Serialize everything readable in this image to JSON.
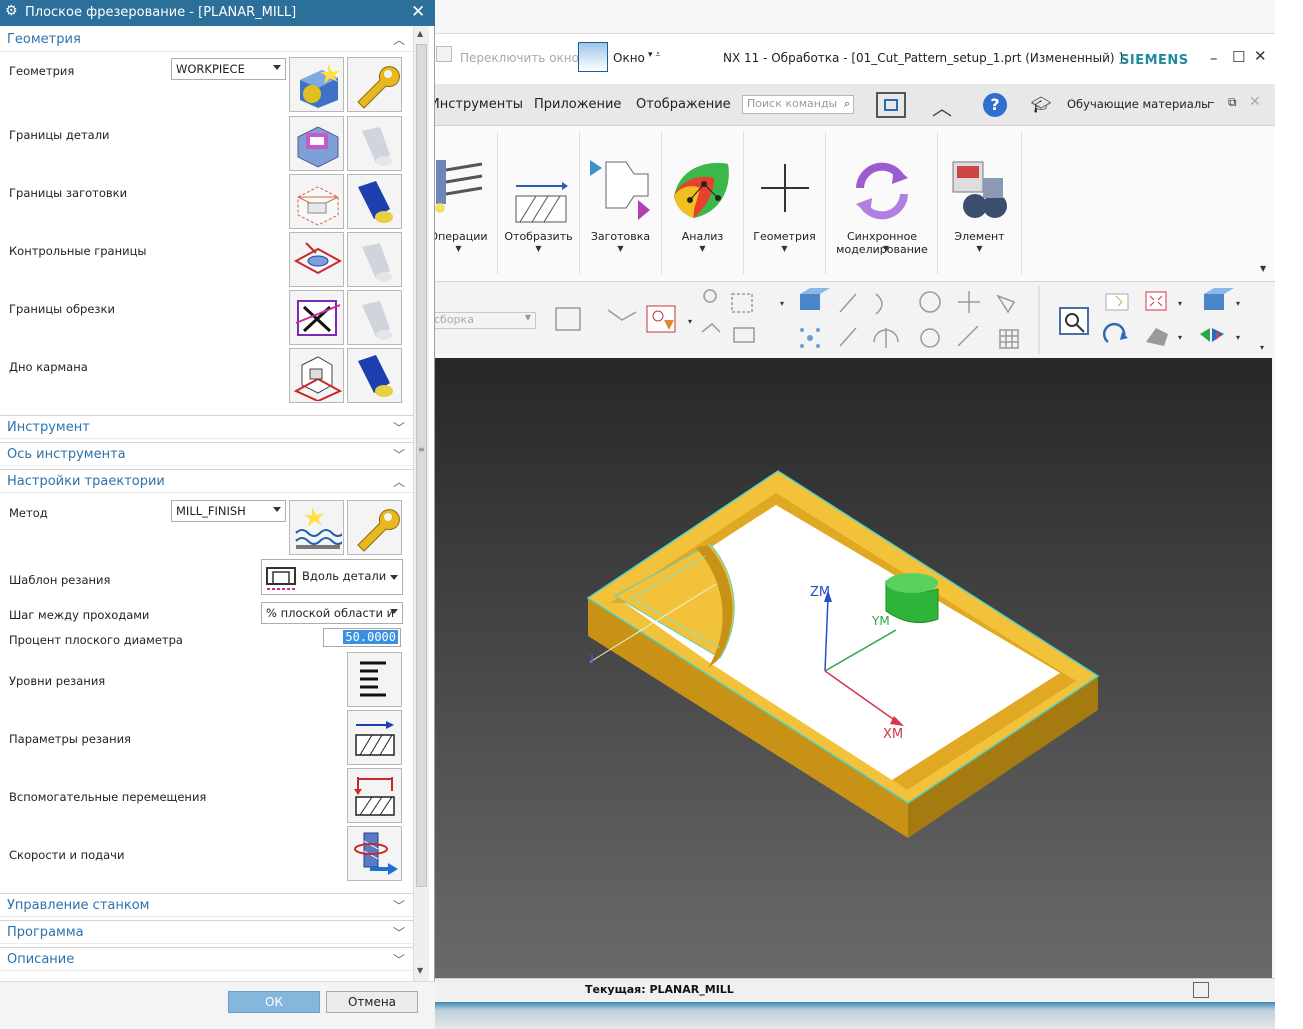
{
  "nx_window": {
    "switch_window": "Переключить окно",
    "window_menu": "Окно",
    "title": "NX 11 - Обработка - [01_Cut_Pattern_setup_1.prt (Измененный) ]",
    "brand": "SIEMENS",
    "menu": [
      "Инструменты",
      "Приложение",
      "Отображение"
    ],
    "search_placeholder": "Поиск команды",
    "learning": "Обучающие материалы",
    "ribbon": [
      {
        "label": "Операции"
      },
      {
        "label": "Отобразить"
      },
      {
        "label": "Заготовка"
      },
      {
        "label": "Анализ"
      },
      {
        "label": "Геометрия"
      },
      {
        "label": "Синхронное моделирование"
      },
      {
        "label": "Элемент"
      }
    ],
    "filter_combo": "сборка",
    "axes": {
      "zm": "ZM",
      "ym": "YM",
      "xm": "XM"
    },
    "status": "Текущая: PLANAR_MILL"
  },
  "dialog": {
    "title": "Плоское фрезерование - [PLANAR_MILL]",
    "sections": {
      "geometry": "Геометрия",
      "tool": "Инструмент",
      "tool_axis": "Ось инструмента",
      "path_settings": "Настройки траектории",
      "machine_control": "Управление станком",
      "program": "Программа",
      "description": "Описание"
    },
    "geometry": {
      "geometry_label": "Геометрия",
      "geometry_value": "WORKPIECE",
      "part_boundaries": "Границы детали",
      "blank_boundaries": "Границы заготовки",
      "check_boundaries": "Контрольные границы",
      "trim_boundaries": "Границы обрезки",
      "floor": "Дно кармана"
    },
    "path": {
      "method_label": "Метод",
      "method_value": "MILL_FINISH",
      "cut_pattern_label": "Шаблон резания",
      "cut_pattern_value": "Вдоль детали",
      "stepover_label": "Шаг между проходами",
      "stepover_value": "% плоской области и",
      "percent_label": "Процент плоского диаметра",
      "percent_value": "50.0000",
      "cut_levels": "Уровни резания",
      "cut_params": "Параметры резания",
      "non_cutting": "Вспомогательные перемещения",
      "feeds_speeds": "Скорости и подачи"
    },
    "ok": "ОК",
    "cancel": "Отмена"
  },
  "colors": {
    "title_bar": "#2c6f9a",
    "section_text": "#2d72ad",
    "part_yellow": "#f2c23a",
    "ok_button": "#85b6db",
    "siemens": "#1f8b9c"
  }
}
